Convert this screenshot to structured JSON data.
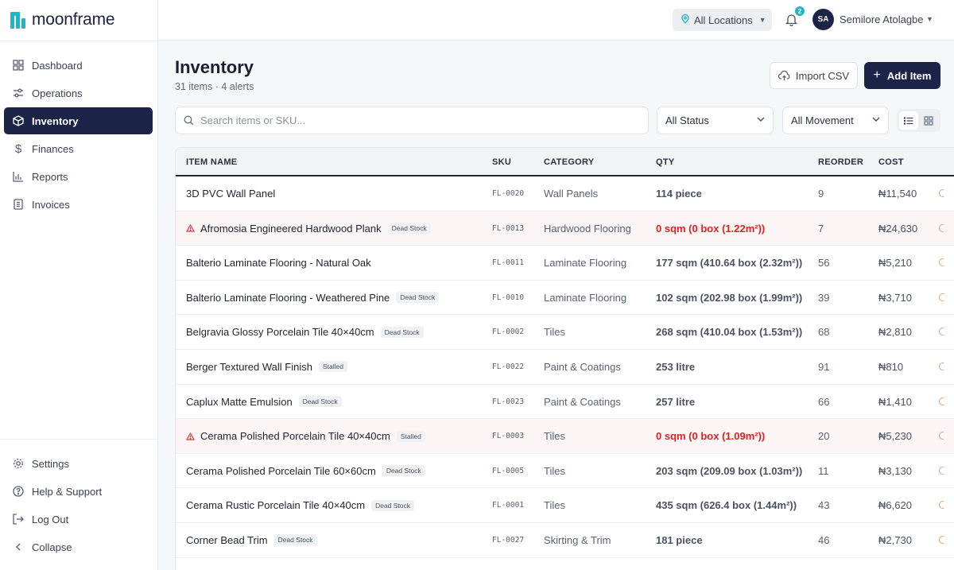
{
  "app": {
    "name": "moonframe"
  },
  "sidebar": {
    "items": [
      {
        "label": "Dashboard",
        "icon": "grid-icon"
      },
      {
        "label": "Operations",
        "icon": "sliders-icon"
      },
      {
        "label": "Inventory",
        "icon": "box-icon",
        "active": true
      },
      {
        "label": "Finances",
        "icon": "dollar-icon"
      },
      {
        "label": "Reports",
        "icon": "bar-chart-icon"
      },
      {
        "label": "Invoices",
        "icon": "receipt-icon"
      }
    ],
    "bottom": [
      {
        "label": "Settings",
        "icon": "gear-icon"
      },
      {
        "label": "Help & Support",
        "icon": "help-icon"
      },
      {
        "label": "Log Out",
        "icon": "logout-icon"
      },
      {
        "label": "Collapse",
        "icon": "chevron-left-icon"
      }
    ]
  },
  "topbar": {
    "location": "All Locations",
    "notifications": "2",
    "user_initials": "SA",
    "user_name": "Semilore Atolagbe"
  },
  "header": {
    "title": "Inventory",
    "subtitle": "31 items · 4 alerts",
    "import_label": "Import CSV",
    "add_label": "Add Item"
  },
  "filters": {
    "search_placeholder": "Search items or SKU...",
    "status": "All Status",
    "movement": "All Movement"
  },
  "table": {
    "columns": {
      "name": "ITEM NAME",
      "sku": "SKU",
      "category": "CATEGORY",
      "qty": "QTY",
      "reorder": "REORDER",
      "cost": "COST"
    },
    "rows": [
      {
        "name": "3D PVC Wall Panel",
        "tag": "",
        "sku": "FL-0020",
        "category": "Wall Panels",
        "qty": "114 piece",
        "reorder": "9",
        "cost": "₦11,540",
        "alert": false
      },
      {
        "name": "Afromosia Engineered Hardwood Plank",
        "tag": "Dead Stock",
        "sku": "FL-0013",
        "category": "Hardwood Flooring",
        "qty": "0 sqm (0 box (1.22m²))",
        "reorder": "7",
        "cost": "₦24,630",
        "alert": true
      },
      {
        "name": "Balterio Laminate Flooring - Natural Oak",
        "tag": "",
        "sku": "FL-0011",
        "category": "Laminate Flooring",
        "qty": "177 sqm (410.64 box (2.32m²))",
        "reorder": "56",
        "cost": "₦5,210",
        "alert": false
      },
      {
        "name": "Balterio Laminate Flooring - Weathered Pine",
        "tag": "Dead Stock",
        "sku": "FL-0010",
        "category": "Laminate Flooring",
        "qty": "102 sqm (202.98 box (1.99m²))",
        "reorder": "39",
        "cost": "₦3,710",
        "alert": false
      },
      {
        "name": "Belgravia Glossy Porcelain Tile 40×40cm",
        "tag": "Dead Stock",
        "sku": "FL-0002",
        "category": "Tiles",
        "qty": "268 sqm (410.04 box (1.53m²))",
        "reorder": "68",
        "cost": "₦2,810",
        "alert": false
      },
      {
        "name": "Berger Textured Wall Finish",
        "tag": "Stalled",
        "sku": "FL-0022",
        "category": "Paint & Coatings",
        "qty": "253 litre",
        "reorder": "91",
        "cost": "₦810",
        "alert": false
      },
      {
        "name": "Caplux Matte Emulsion",
        "tag": "Dead Stock",
        "sku": "FL-0023",
        "category": "Paint & Coatings",
        "qty": "257 litre",
        "reorder": "66",
        "cost": "₦1,410",
        "alert": false
      },
      {
        "name": "Cerama Polished Porcelain Tile 40×40cm",
        "tag": "Stalled",
        "sku": "FL-0003",
        "category": "Tiles",
        "qty": "0 sqm (0 box (1.09m²))",
        "reorder": "20",
        "cost": "₦5,230",
        "alert": true
      },
      {
        "name": "Cerama Polished Porcelain Tile 60×60cm",
        "tag": "Dead Stock",
        "sku": "FL-0005",
        "category": "Tiles",
        "qty": "203 sqm (209.09 box (1.03m²))",
        "reorder": "11",
        "cost": "₦3,130",
        "alert": false
      },
      {
        "name": "Cerama Rustic Porcelain Tile 40×40cm",
        "tag": "Dead Stock",
        "sku": "FL-0001",
        "category": "Tiles",
        "qty": "435 sqm (626.4 box (1.44m²))",
        "reorder": "43",
        "cost": "₦6,620",
        "alert": false
      },
      {
        "name": "Corner Bead Trim",
        "tag": "Dead Stock",
        "sku": "FL-0027",
        "category": "Skirting & Trim",
        "qty": "181 piece",
        "reorder": "46",
        "cost": "₦2,730",
        "alert": false
      }
    ]
  },
  "colors": {
    "brand": "#1fb5c8",
    "primary": "#1b2347",
    "alert": "#e02020"
  }
}
